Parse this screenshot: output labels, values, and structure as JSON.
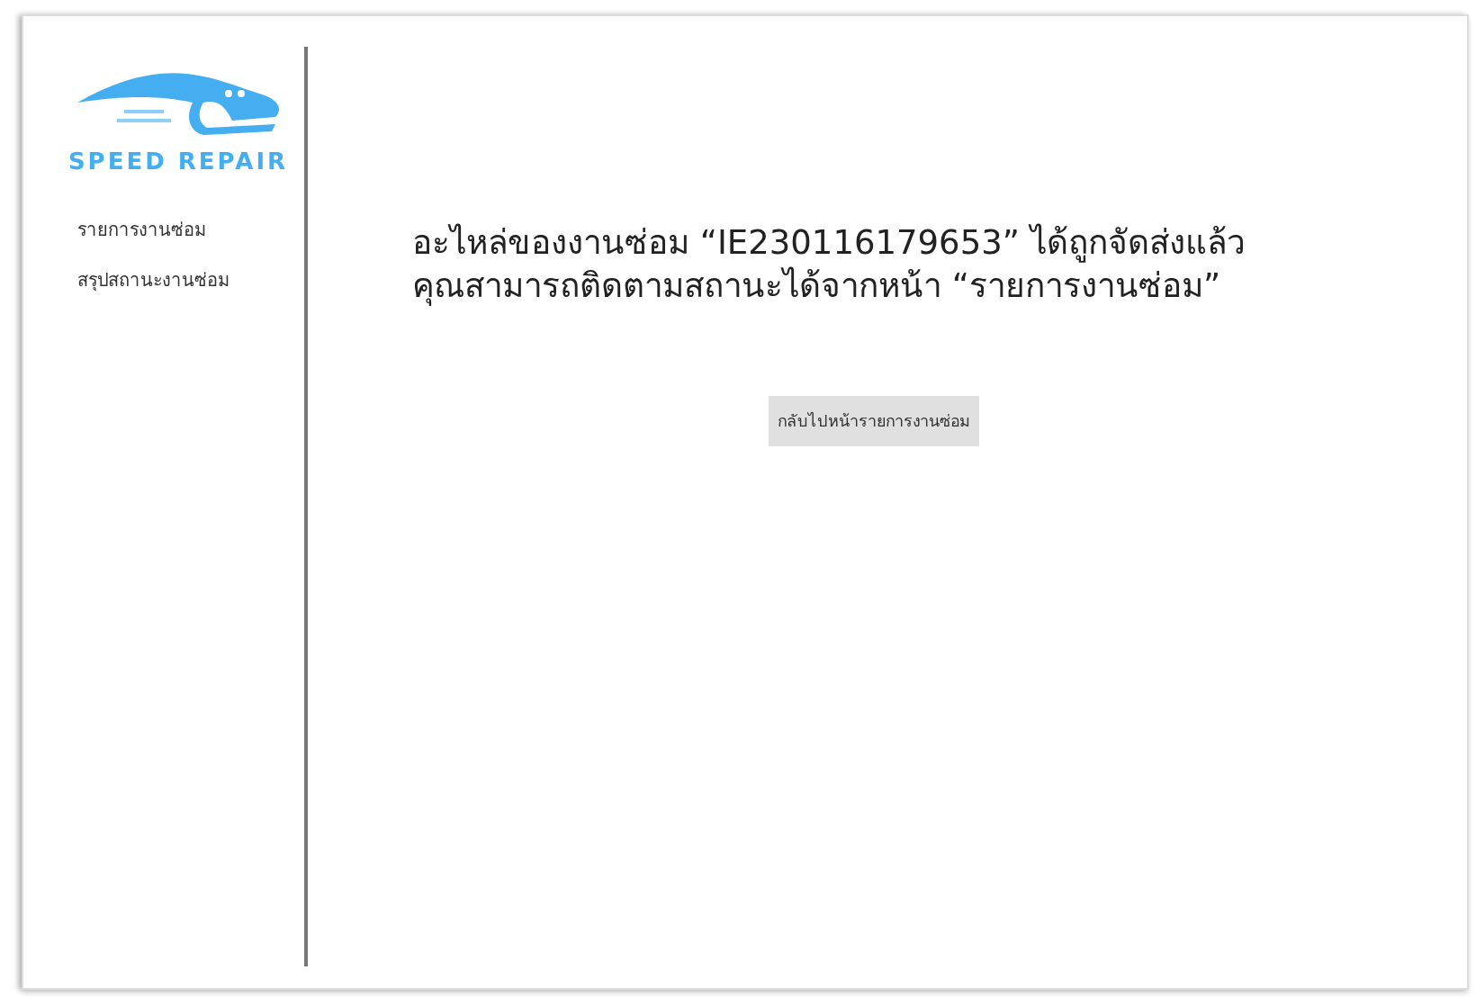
{
  "sidebar": {
    "logo_text": "SPEED REPAIR",
    "items": [
      {
        "label": "รายการงานซ่อม"
      },
      {
        "label": "สรุปสถานะงานซ่อม"
      }
    ]
  },
  "message": {
    "lines": [
      "อะไหล่ของงานซ่อม “IE230116179653” ได้ถูกจัดส่งแล้ว",
      "คุณสามารถติดตามสถานะได้จากหน้า “รายการงานซ่อม”"
    ]
  },
  "back_button": "กลับไปหน้ารายการงานซ่อม"
}
